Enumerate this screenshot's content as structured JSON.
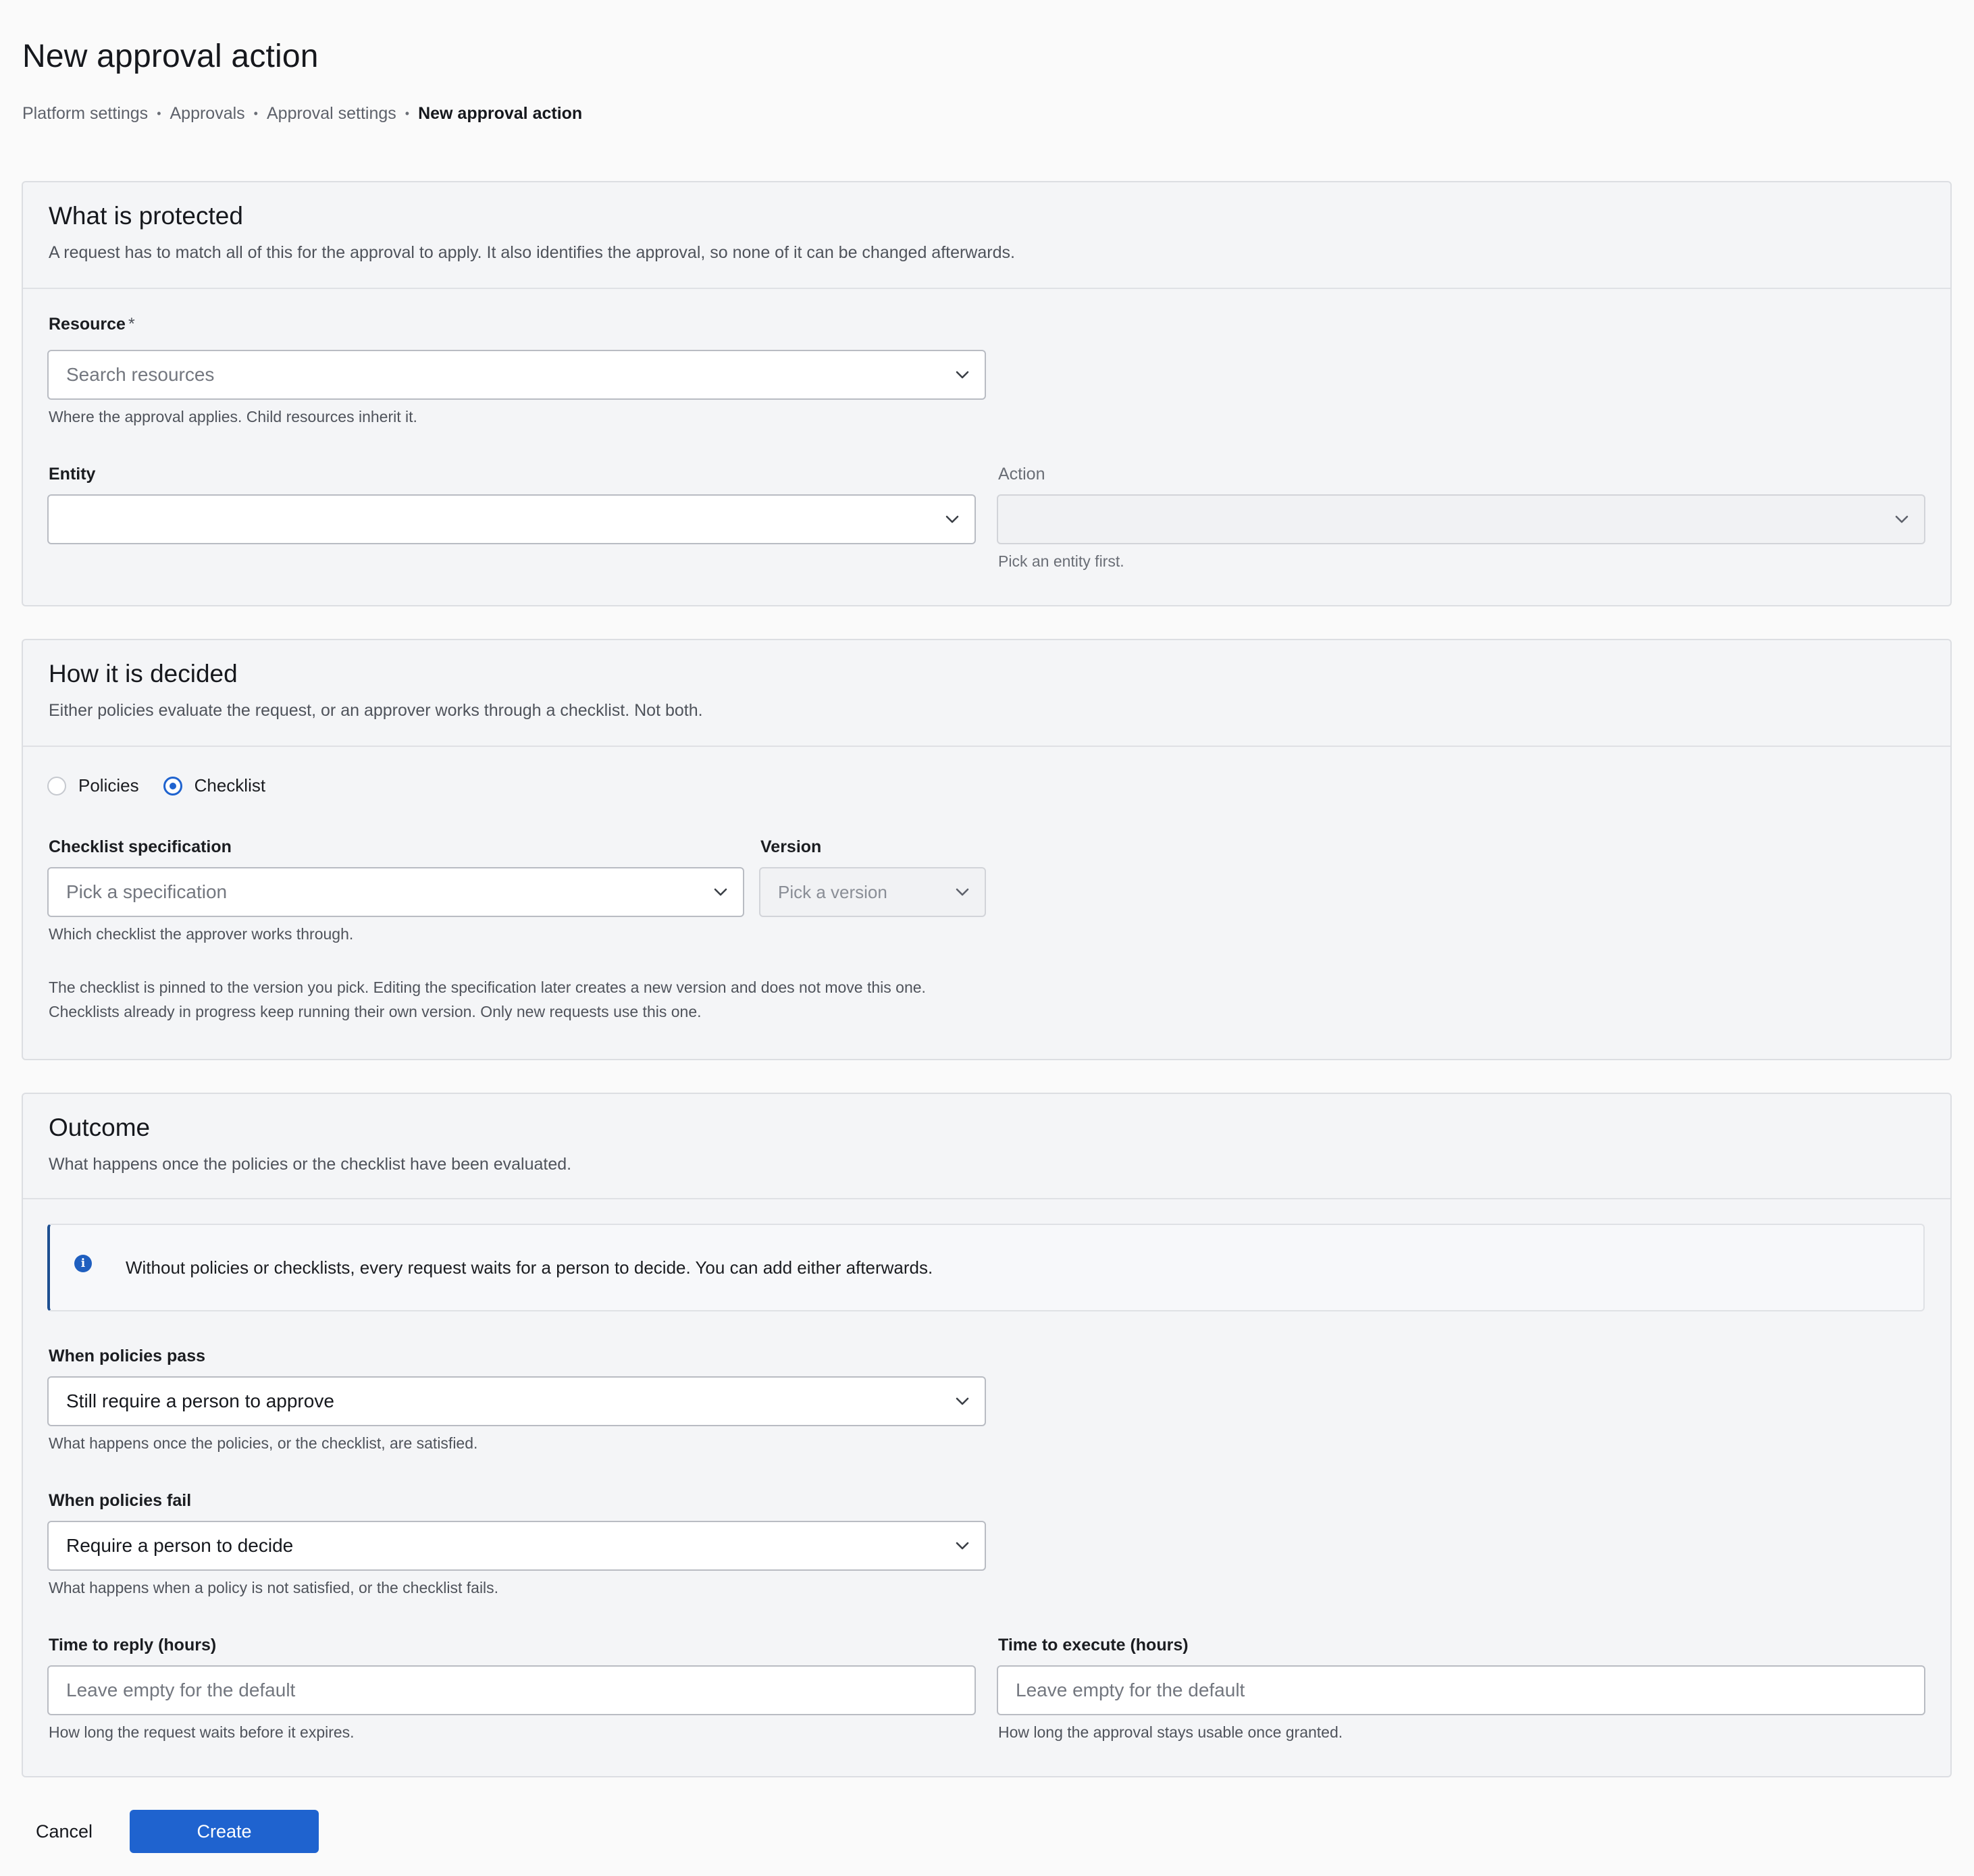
{
  "page": {
    "title": "New approval action"
  },
  "breadcrumb": {
    "items": [
      "Platform settings",
      "Approvals",
      "Approval settings"
    ],
    "current": "New approval action",
    "separator": "•"
  },
  "protected": {
    "title": "What is protected",
    "description": "A request has to match all of this for the approval to apply. It also identifies the approval, so none of it can be changed afterwards.",
    "resource": {
      "label": "Resource",
      "required_mark": "*",
      "placeholder": "Search resources",
      "help": "Where the approval applies. Child resources inherit it."
    },
    "entity": {
      "label": "Entity",
      "value": ""
    },
    "action": {
      "label": "Action",
      "value": "",
      "help": "Pick an entity first."
    }
  },
  "decided": {
    "title": "How it is decided",
    "description": "Either policies evaluate the request, or an approver works through a checklist. Not both.",
    "options": [
      {
        "label": "Policies",
        "checked": false
      },
      {
        "label": "Checklist",
        "checked": true
      }
    ],
    "specification": {
      "label": "Checklist specification",
      "placeholder": "Pick a specification",
      "help": "Which checklist the approver works through."
    },
    "version": {
      "label": "Version",
      "placeholder": "Pick a version"
    },
    "note_line1": "The checklist is pinned to the version you pick. Editing the specification later creates a new version and does not move this one.",
    "note_line2": "Checklists already in progress keep running their own version. Only new requests use this one."
  },
  "outcome": {
    "title": "Outcome",
    "description": "What happens once the policies or the checklist have been evaluated.",
    "info_icon_glyph": "i",
    "info": "Without policies or checklists, every request waits for a person to decide. You can add either afterwards.",
    "pass": {
      "label": "When policies pass",
      "value": "Still require a person to approve",
      "help": "What happens once the policies, or the checklist, are satisfied."
    },
    "fail": {
      "label": "When policies fail",
      "value": "Require a person to decide",
      "help": "What happens when a policy is not satisfied, or the checklist fails."
    },
    "reply": {
      "label": "Time to reply (hours)",
      "placeholder": "Leave empty for the default",
      "help": "How long the request waits before it expires."
    },
    "execute": {
      "label": "Time to execute (hours)",
      "placeholder": "Leave empty for the default",
      "help": "How long the approval stays usable once granted."
    }
  },
  "actions": {
    "cancel": "Cancel",
    "create": "Create"
  },
  "colors": {
    "primary": "#1f63cf",
    "info_accent": "#1d4f91"
  }
}
